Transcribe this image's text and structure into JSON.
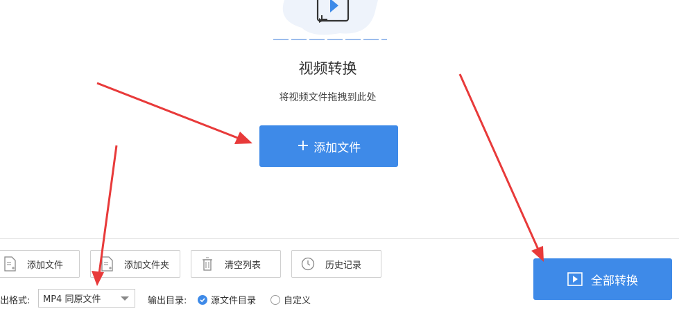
{
  "main": {
    "title": "视频转换",
    "subtitle": "将视频文件拖拽到此处",
    "add_file_button": "添加文件"
  },
  "toolbar": {
    "add_file": "添加文件",
    "add_folder": "添加文件夹",
    "clear_list": "清空列表",
    "history": "历史记录"
  },
  "output": {
    "format_label": "出格式:",
    "format_value": "MP4 同原文件",
    "dir_label": "输出目录:",
    "dir_source": "源文件目录",
    "dir_custom": "自定义"
  },
  "convert_all_button": "全部转换",
  "colors": {
    "accent": "#3e8ae8",
    "annotation_arrow": "#e83a3a"
  }
}
